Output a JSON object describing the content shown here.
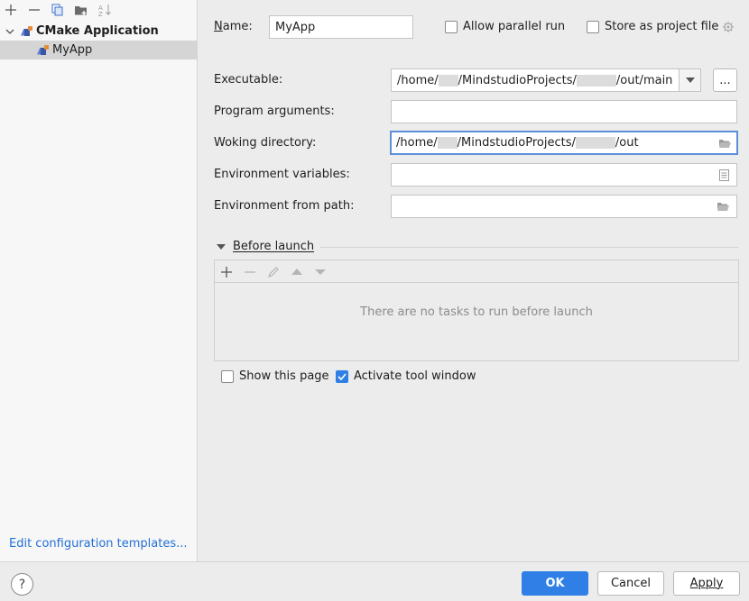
{
  "sidebar": {
    "toolbar_icons": [
      "add-icon",
      "remove-icon",
      "copy-icon",
      "folder-add-icon",
      "sort-icon"
    ],
    "group_label": "CMake Application",
    "item_label": "MyApp",
    "edit_templates_label": "Edit configuration templates..."
  },
  "form": {
    "name_label": "Name:",
    "name_value": "MyApp",
    "allow_parallel_label": "Allow parallel run",
    "store_project_label": "Store as project file",
    "executable_label": "Executable:",
    "executable_prefix": "/home/",
    "executable_mid": "/MindstudioProjects/",
    "executable_suffix": "/out/main",
    "browse_label": "...",
    "program_args_label": "Program arguments:",
    "program_args_value": "",
    "working_dir_label": "Woking directory:",
    "working_dir_prefix": "/home/",
    "working_dir_mid": "/MindstudioProjects/",
    "working_dir_suffix": "/out",
    "env_vars_label": "Environment variables:",
    "env_vars_value": "",
    "env_path_label": "Environment from path:",
    "env_path_value": ""
  },
  "before_launch": {
    "title": "Before launch",
    "empty_text": "There are no tasks to run before launch",
    "toolbar_icons": [
      "add-icon",
      "remove-icon",
      "edit-icon",
      "move-up-icon",
      "move-down-icon"
    ]
  },
  "options": {
    "show_page_label": "Show this page",
    "show_page_checked": false,
    "activate_tool_label": "Activate tool window",
    "activate_tool_checked": true
  },
  "buttons": {
    "help": "?",
    "ok": "OK",
    "cancel": "Cancel",
    "apply": "Apply"
  },
  "colors": {
    "accent": "#2f7fe6",
    "link": "#2470d6"
  }
}
